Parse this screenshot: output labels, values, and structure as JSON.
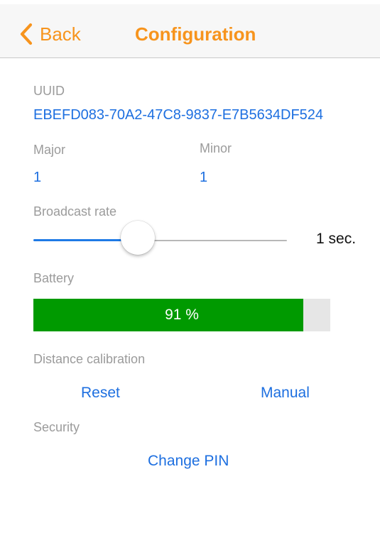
{
  "nav": {
    "back_label": "Back",
    "title": "Configuration",
    "accent_color": "#f7941d"
  },
  "uuid": {
    "label": "UUID",
    "value": "EBEFD083-70A2-47C8-9837-E7B5634DF524"
  },
  "major": {
    "label": "Major",
    "value": "1"
  },
  "minor": {
    "label": "Minor",
    "value": "1"
  },
  "broadcast": {
    "label": "Broadcast rate",
    "value_label": "1 sec.",
    "slider_fraction": 0.41
  },
  "battery": {
    "label": "Battery",
    "percent": 91,
    "value_label": "91 %",
    "fill_color": "#009a00"
  },
  "distance": {
    "label": "Distance calibration",
    "reset_label": "Reset",
    "manual_label": "Manual"
  },
  "security": {
    "label": "Security",
    "change_pin_label": "Change PIN"
  },
  "colors": {
    "link": "#1d6fe0",
    "label": "#9b9b9b"
  }
}
